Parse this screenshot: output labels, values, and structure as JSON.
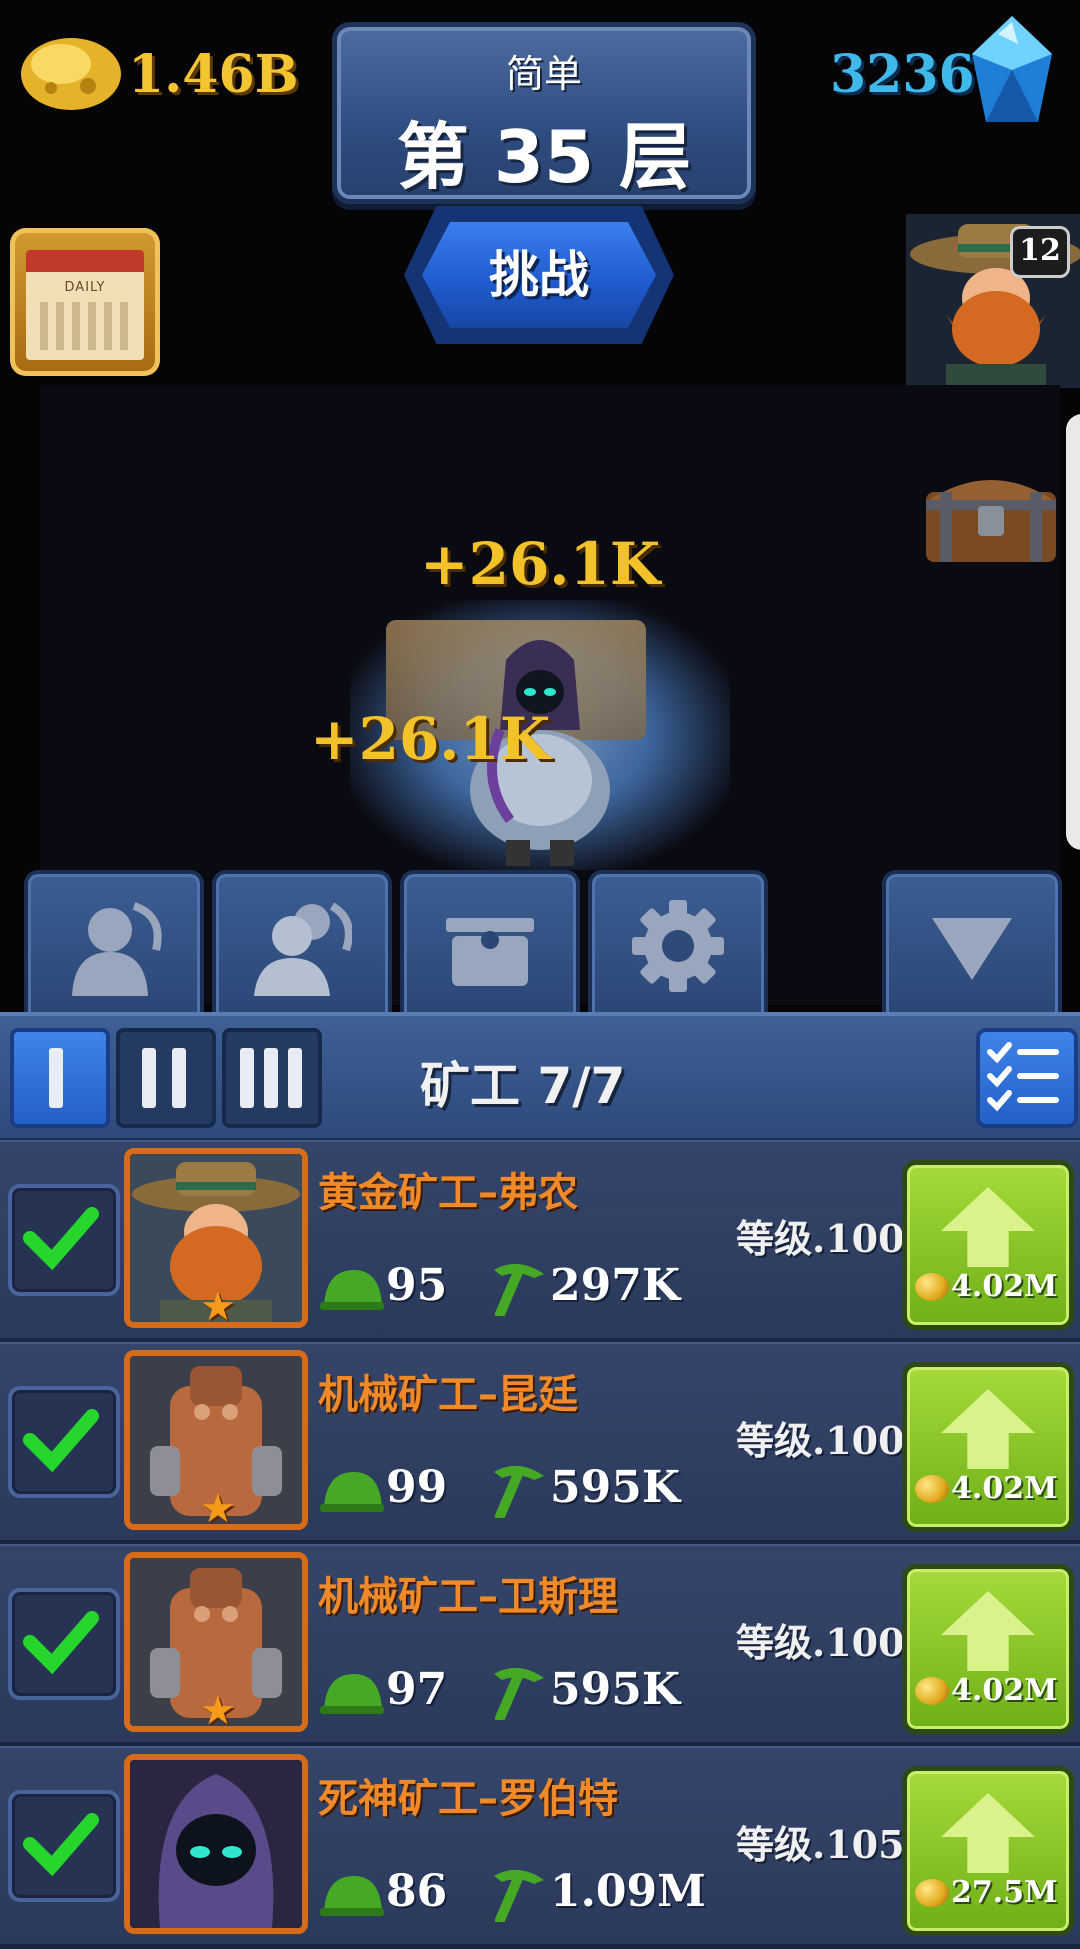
{
  "header": {
    "gold": "1.46B",
    "gems": "3236",
    "difficulty": "简单",
    "floor": "第 35 层",
    "challenge_label": "挑战",
    "dwarf_badge": "12"
  },
  "scene": {
    "rewards": [
      "+26.1K",
      "+26.1K"
    ]
  },
  "action_tabs": [
    "single-miner-icon",
    "multi-miner-icon",
    "chest-icon",
    "gear-icon",
    "collapse-arrow-icon"
  ],
  "panel": {
    "miner_count": "矿工  7/7",
    "level_tabs": [
      "I",
      "II",
      "III"
    ],
    "active_tab": 0
  },
  "miners": [
    {
      "name": "黄金矿工–弗农",
      "level": "等级.100",
      "helmet": "95",
      "pick": "297K",
      "cost": "4.02M",
      "checked": true
    },
    {
      "name": "机械矿工–昆廷",
      "level": "等级.100",
      "helmet": "99",
      "pick": "595K",
      "cost": "4.02M",
      "checked": true
    },
    {
      "name": "机械矿工–卫斯理",
      "level": "等级.100",
      "helmet": "97",
      "pick": "595K",
      "cost": "4.02M",
      "checked": true
    },
    {
      "name": "死神矿工–罗伯特",
      "level": "等级.105",
      "helmet": "86",
      "pick": "1.09M",
      "cost": "27.5M",
      "checked": true
    }
  ],
  "colors": {
    "gold_text": "#f4c531",
    "gem_text": "#3fb8ea",
    "name_text": "#f08a28",
    "check": "#27d62c"
  }
}
